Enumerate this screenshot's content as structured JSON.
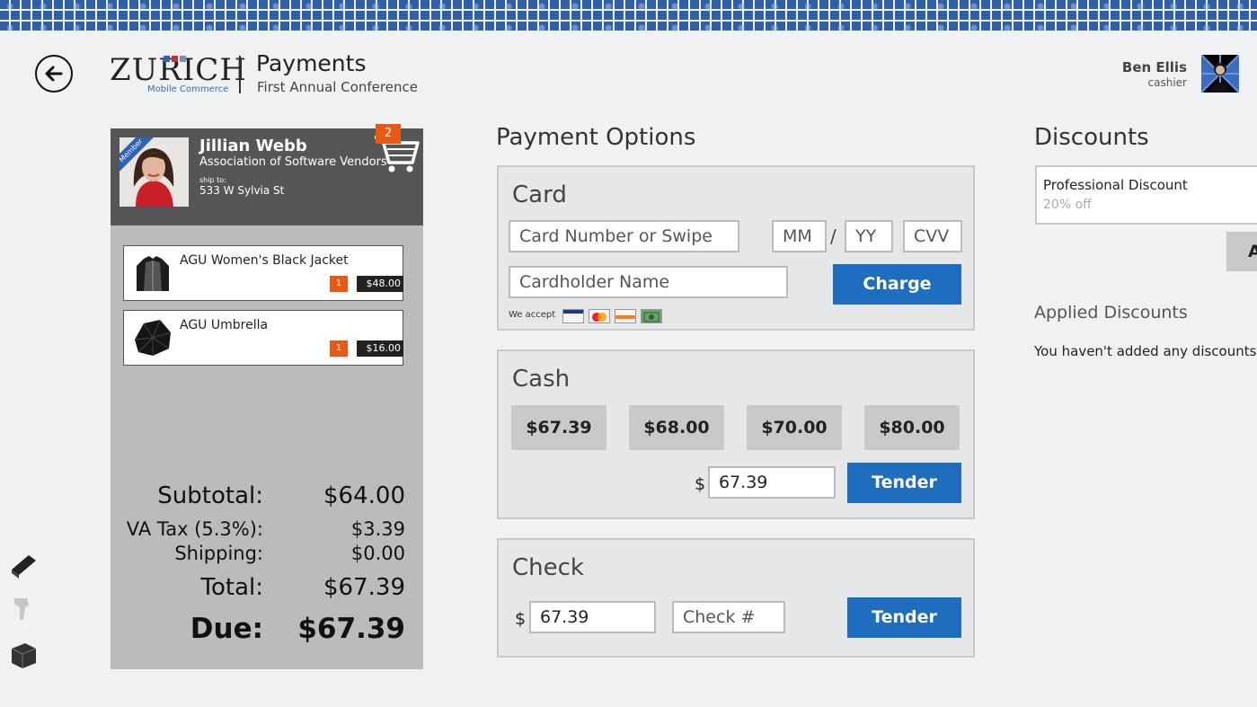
{
  "header": {
    "logo_text": "ZURICH",
    "logo_sub": "Mobile Commerce",
    "title": "Payments",
    "subtitle": "First Annual Conference"
  },
  "user": {
    "name": "Ben Ellis",
    "role": "cashier"
  },
  "customer": {
    "badge": "Member",
    "name": "Jillian Webb",
    "org": "Association of Software Vendors",
    "ship_to_label": "ship to:",
    "address": "533 W Sylvia St",
    "cart_count": "2"
  },
  "cart": {
    "items": [
      {
        "name": "AGU Women's Black Jacket",
        "qty": "1",
        "price": "$48.00"
      },
      {
        "name": "AGU Umbrella",
        "qty": "1",
        "price": "$16.00"
      }
    ],
    "totals": {
      "subtotal_label": "Subtotal:",
      "subtotal": "$64.00",
      "tax_label": "VA Tax (5.3%):",
      "tax": "$3.39",
      "shipping_label": "Shipping:",
      "shipping": "$0.00",
      "total_label": "Total:",
      "total": "$67.39",
      "due_label": "Due:",
      "due": "$67.39"
    }
  },
  "payment": {
    "title": "Payment Options",
    "card": {
      "title": "Card",
      "number_placeholder": "Card Number or Swipe",
      "mm_placeholder": "MM",
      "slash": "/",
      "yy_placeholder": "YY",
      "cvv_placeholder": "CVV",
      "name_placeholder": "Cardholder Name",
      "charge_label": "Charge",
      "we_accept": "We accept",
      "cards": [
        "visa-icon",
        "mastercard-icon",
        "discover-icon",
        "cash-icon"
      ]
    },
    "cash": {
      "title": "Cash",
      "quick_amounts": [
        "$67.39",
        "$68.00",
        "$70.00",
        "$80.00"
      ],
      "currency": "$",
      "amount": "67.39",
      "tender_label": "Tender"
    },
    "check": {
      "title": "Check",
      "currency": "$",
      "amount": "67.39",
      "check_placeholder": "Check #",
      "tender_label": "Tender"
    }
  },
  "discounts": {
    "title": "Discounts",
    "available": {
      "name": "Professional Discount",
      "percent": "20% off"
    },
    "add_label": "A",
    "applied_title": "Applied Discounts",
    "applied_empty": "You haven't added any discounts yet."
  },
  "colors": {
    "accent": "#1f6dbf",
    "badge": "#e85a13",
    "panel": "#555658"
  }
}
